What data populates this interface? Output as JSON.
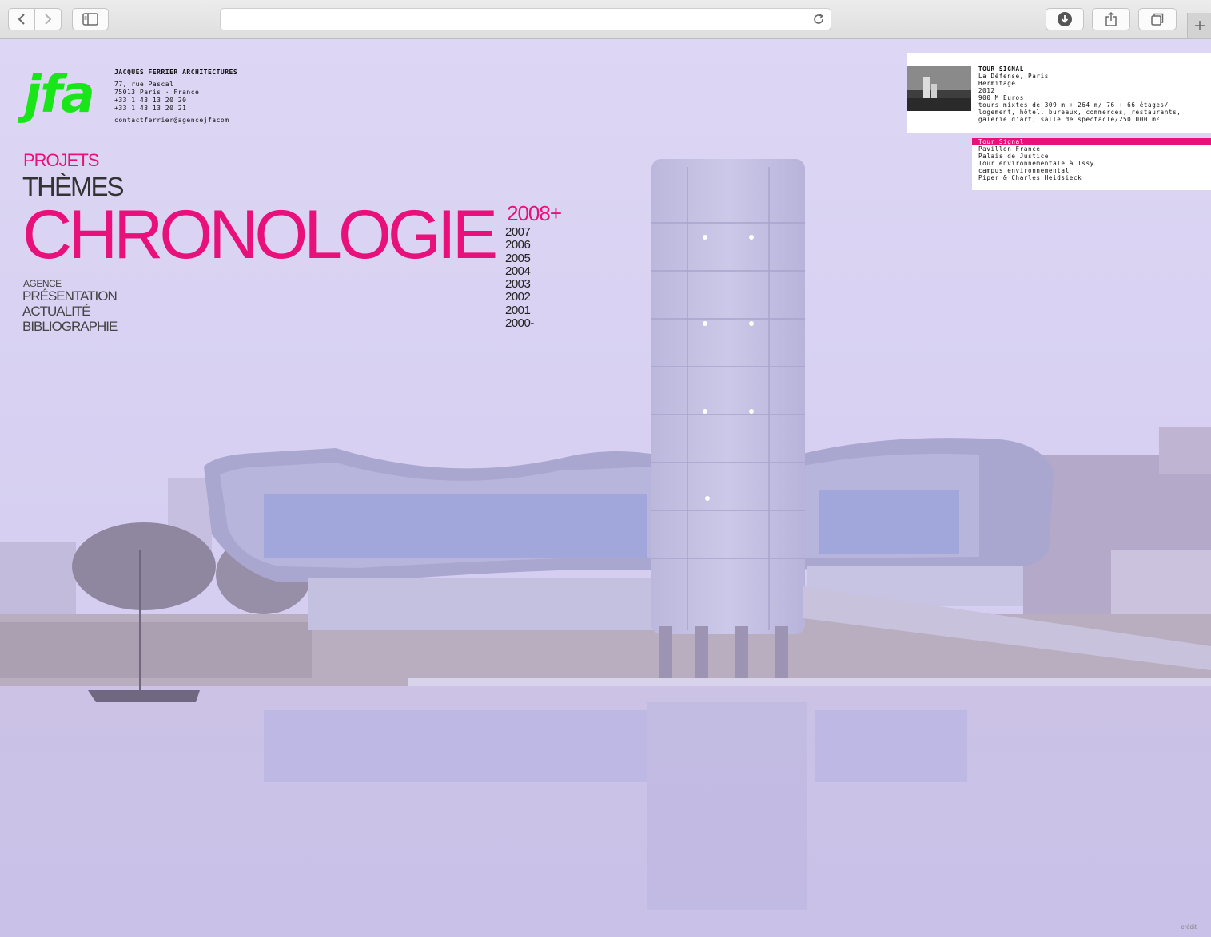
{
  "colors": {
    "accent_pink": "#e8107a",
    "logo_green": "#19e619"
  },
  "browser": {
    "back_icon": "chevron-left-icon",
    "forward_icon": "chevron-right-icon",
    "sidebar_icon": "sidebar-icon",
    "reload_icon": "reload-icon",
    "download_icon": "download-icon",
    "share_icon": "share-icon",
    "tabs_icon": "tabs-icon",
    "new_tab_icon": "plus-icon",
    "address_value": ""
  },
  "brand": {
    "logo": "jfa",
    "firm_name": "JACQUES FERRIER ARCHITECTURES",
    "address_line1": "77, rue Pascal",
    "address_line2": "75013 Paris · France",
    "phone1": "+33 1 43 13 20 20",
    "phone2": "+33 1 43 13 20 21",
    "email": "contactferrier@agencejfacom"
  },
  "nav": {
    "projets": "PROJETS",
    "themes": "THÈMES",
    "chronologie": "CHRONOLOGIE",
    "current_year": "2008+",
    "years": [
      "2007",
      "2006",
      "2005",
      "2004",
      "2003",
      "2002",
      "2001",
      "2000-"
    ],
    "agence": "AGENCE",
    "agence_links": [
      "PRÉSENTATION",
      "ACTUALITÉ",
      "BIBLIOGRAPHIE"
    ]
  },
  "project": {
    "title": "TOUR SIGNAL",
    "location": "La Défense, Paris",
    "client": "Hermitage",
    "year": "2012",
    "budget": "900 M Euros",
    "desc1": "tours mixtes de 309 m + 264 m/ 76 + 66 étages/",
    "desc2": "logement, hôtel, bureaux, commerces, restaurants,",
    "desc3": "galerie d'art, salle de spectacle/250 000 m²"
  },
  "project_list": [
    "Tour Signal",
    "Pavillon France",
    "Palais de Justice",
    "Tour environnementale à Issy",
    "campus environnemental",
    "Piper & Charles Heidsieck"
  ],
  "footer": {
    "credit": "crédit"
  }
}
